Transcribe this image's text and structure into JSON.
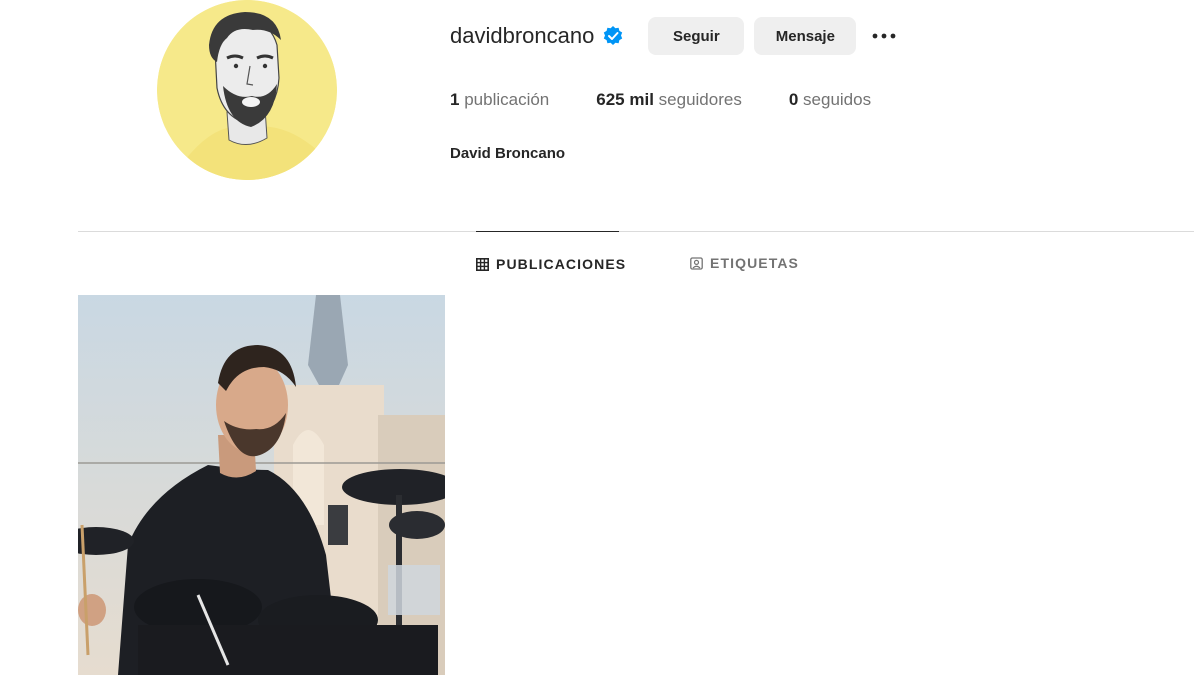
{
  "profile": {
    "username": "davidbroncano",
    "full_name": "David Broncano",
    "verified": true
  },
  "actions": {
    "follow_label": "Seguir",
    "message_label": "Mensaje",
    "more_label": "•••"
  },
  "stats": {
    "posts_count": "1",
    "posts_label": "publicación",
    "followers_count": "625 mil",
    "followers_label": "seguidores",
    "following_count": "0",
    "following_label": "seguidos"
  },
  "tabs": [
    {
      "label": "PUBLICACIONES",
      "active": true,
      "icon": "grid-icon"
    },
    {
      "label": "ETIQUETAS",
      "active": false,
      "icon": "tagged-icon"
    }
  ],
  "colors": {
    "verified_badge": "#0095f6",
    "avatar_bg": "#f6e98a",
    "button_bg": "#efefef"
  }
}
